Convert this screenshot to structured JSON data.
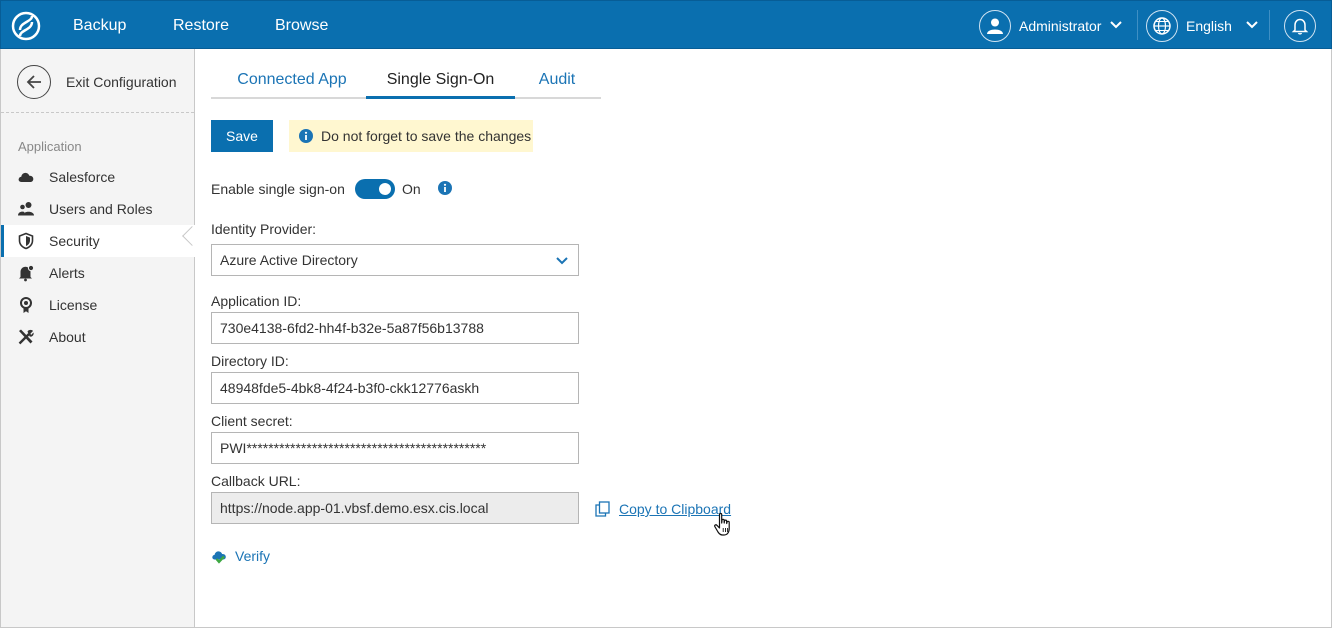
{
  "topbar": {
    "nav": [
      "Backup",
      "Restore",
      "Browse"
    ],
    "user": "Administrator",
    "language": "English"
  },
  "sidebar": {
    "exit_label": "Exit Configuration",
    "section_label": "Application",
    "items": [
      {
        "label": "Salesforce",
        "icon": "cloud-icon"
      },
      {
        "label": "Users and Roles",
        "icon": "users-icon"
      },
      {
        "label": "Security",
        "icon": "shield-icon"
      },
      {
        "label": "Alerts",
        "icon": "bell-icon"
      },
      {
        "label": "License",
        "icon": "license-icon"
      },
      {
        "label": "About",
        "icon": "tools-icon"
      }
    ],
    "active_item": "Security"
  },
  "main": {
    "tabs": [
      "Connected App",
      "Single Sign-On",
      "Audit"
    ],
    "active_tab": "Single Sign-On",
    "save_label": "Save",
    "notice": "Do not forget to save the changes",
    "sso_label": "Enable single sign-on",
    "sso_state": "On",
    "identity_provider_label": "Identity Provider:",
    "identity_provider_value": "Azure Active Directory",
    "app_id_label": "Application ID:",
    "app_id_value": "730e4138-6fd2-hh4f-b32e-5a87f56b13788",
    "directory_id_label": "Directory ID:",
    "directory_id_value": "48948fde5-4bk8-4f24-b3f0-ckk12776askh",
    "client_secret_label": "Client secret:",
    "client_secret_value": "PWI********************************************",
    "callback_label": "Callback URL:",
    "callback_value": "https://node.app-01.vbsf.demo.esx.cis.local",
    "copy_label": "Copy to Clipboard",
    "verify_label": "Verify"
  },
  "colors": {
    "brand": "#0a6faf",
    "link": "#1b74b5",
    "notice_bg": "#fff7d0"
  }
}
